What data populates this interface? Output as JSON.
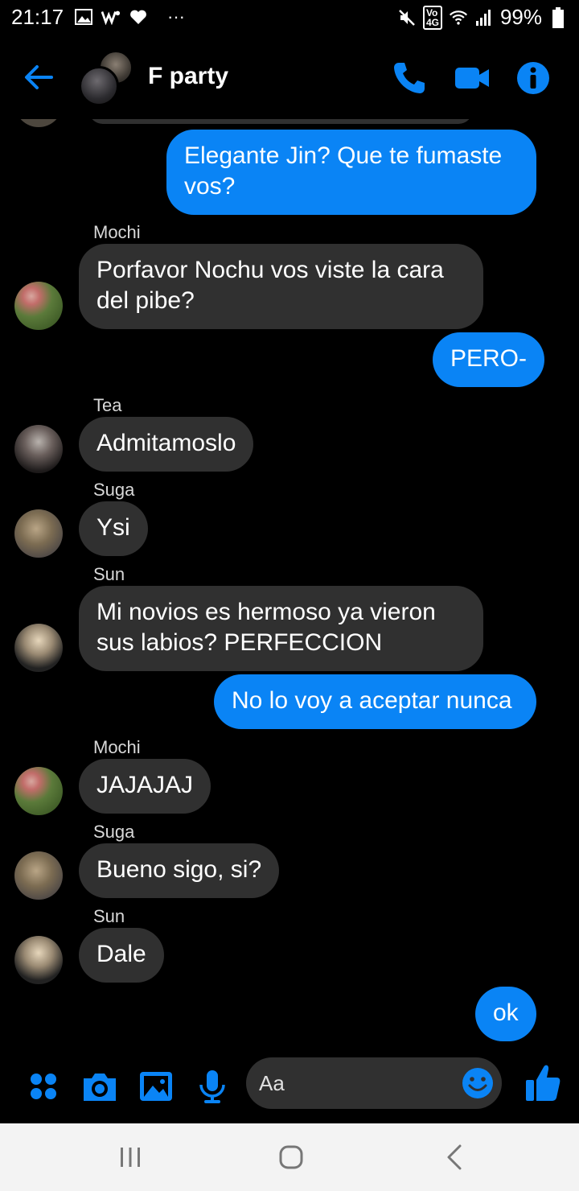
{
  "status_bar": {
    "time": "21:17",
    "more": "···",
    "network": "4G",
    "battery": "99%"
  },
  "header": {
    "title": "F party"
  },
  "messages": [
    {
      "direction": "out",
      "text": "Elegante Jin? Que te fumaste vos?"
    },
    {
      "direction": "in",
      "sender": "Mochi",
      "text": "Porfavor Nochu vos viste la cara del pibe?"
    },
    {
      "direction": "out",
      "text": "PERO-"
    },
    {
      "direction": "in",
      "sender": "Tea",
      "text": "Admitamoslo"
    },
    {
      "direction": "in",
      "sender": "Suga",
      "text": "Ysi"
    },
    {
      "direction": "in",
      "sender": "Sun",
      "text": "Mi novios es hermoso ya vieron sus labios? PERFECCION"
    },
    {
      "direction": "out",
      "text": "No lo voy a aceptar nunca"
    },
    {
      "direction": "in",
      "sender": "Mochi",
      "text": "JAJAJAJ"
    },
    {
      "direction": "in",
      "sender": "Suga",
      "text": "Bueno sigo, si?"
    },
    {
      "direction": "in",
      "sender": "Sun",
      "text": "Dale"
    },
    {
      "direction": "out",
      "text": "ok"
    }
  ],
  "composer": {
    "placeholder": "Aa"
  },
  "colors": {
    "accent": "#0a84f5",
    "incoming_bubble": "#303030",
    "background": "#000000"
  }
}
